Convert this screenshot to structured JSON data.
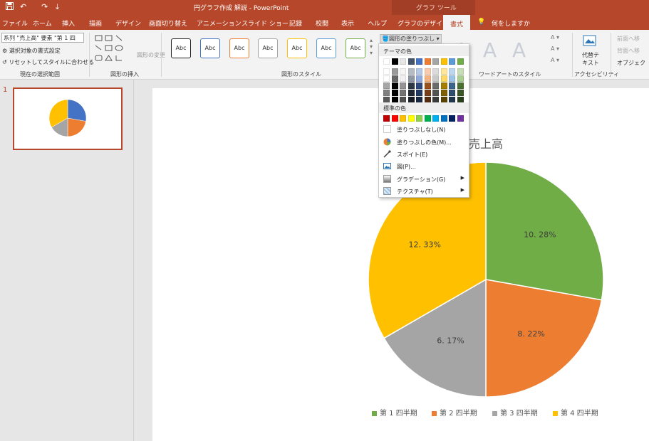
{
  "title_bar": {
    "document_title": "円グラフ作成 解説 - PowerPoint",
    "context_title": "グラフ ツール",
    "quick_access": [
      "save-icon",
      "undo-icon",
      "redo-icon",
      "customize-icon"
    ]
  },
  "tabs": [
    "ファイル",
    "ホーム",
    "挿入",
    "描画",
    "デザイン",
    "画面切り替え",
    "アニメーション",
    "スライド ショー",
    "記録",
    "校閲",
    "表示",
    "ヘルプ",
    "グラフのデザイン",
    "書式"
  ],
  "active_tab": "書式",
  "tell_me": "何をしますか",
  "ribbon": {
    "selection_dropdown": "系列 \"売上高\" 要素 \"第 1 四",
    "format_selection": "選択対象の書式設定",
    "reset_style": "リセットしてスタイルに合わせる",
    "group_current_selection": "現在の選択範囲",
    "group_insert_shapes": "図形の挿入",
    "change_shape": "図形の変更",
    "group_shape_styles": "図形のスタイル",
    "style_sample": "Abc",
    "shape_fill": "図形の塗りつぶし",
    "group_wordart": "ワードアートのスタイル",
    "wordart_letter": "A",
    "alt_text": "代替テキスト",
    "group_accessibility": "アクセシビリティ",
    "bring_forward": "前面へ移",
    "send_backward": "背面へ移",
    "selection_pane": "オブジェク"
  },
  "fill_menu": {
    "theme_colors_header": "テーマの色",
    "standard_colors_header": "標準の色",
    "no_fill": "塗りつぶしなし(N)",
    "more_colors": "塗りつぶしの色(M)...",
    "eyedropper": "スポイト(E)",
    "picture": "図(P)...",
    "gradient": "グラデーション(G)",
    "texture": "テクスチャ(T)",
    "theme_colors": [
      "#ffffff",
      "#000000",
      "#e7e6e6",
      "#44546a",
      "#4472c4",
      "#ed7d31",
      "#a5a5a5",
      "#ffc000",
      "#5b9bd5",
      "#70ad47"
    ],
    "standard_colors": [
      "#c00000",
      "#ff0000",
      "#ffc000",
      "#ffff00",
      "#92d050",
      "#00b050",
      "#00b0f0",
      "#0070c0",
      "#002060",
      "#7030a0"
    ]
  },
  "slide_panel": {
    "slide_number": "1"
  },
  "chart_data": {
    "type": "pie",
    "title": "売上高",
    "categories": [
      "第 1 四半期",
      "第 2 四半期",
      "第 3 四半期",
      "第 4 四半期"
    ],
    "values": [
      10.28,
      8.22,
      6.17,
      12.33
    ],
    "data_labels": [
      "10. 28%",
      "8. 22%",
      "6. 17%",
      "12. 33%"
    ],
    "colors": [
      "#70ad47",
      "#ed7d31",
      "#a5a5a5",
      "#ffc000"
    ],
    "legend_position": "bottom"
  },
  "thumbnail_chart": {
    "values": [
      10.28,
      8.22,
      6.17,
      12.33
    ],
    "colors": [
      "#4472c4",
      "#ed7d31",
      "#a5a5a5",
      "#ffc000"
    ]
  }
}
